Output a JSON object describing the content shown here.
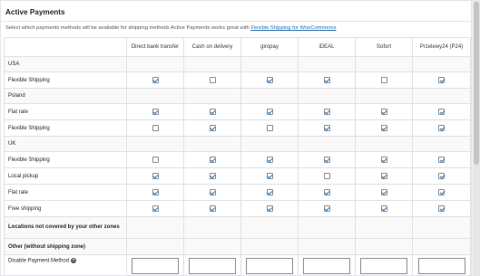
{
  "section": {
    "title": "Active Payments",
    "description_prefix": "Select which payments methods will be available for shipping methods Active Payments works great with ",
    "description_link": "Flexible Shipping for WooCommerce"
  },
  "columns": [
    "Direct bank transfer",
    "Cash on delivery",
    "giropay",
    "iDEAL",
    "Sofort",
    "Przelewy24 (P24)"
  ],
  "rows": [
    {
      "type": "group",
      "label": "USA"
    },
    {
      "type": "method",
      "label": "Flexible Shipping",
      "checks": [
        true,
        false,
        true,
        true,
        false,
        true
      ]
    },
    {
      "type": "group",
      "label": "Poland"
    },
    {
      "type": "method",
      "label": "Flat rate",
      "checks": [
        true,
        true,
        true,
        true,
        true,
        true
      ]
    },
    {
      "type": "method",
      "label": "Flexible Shipping",
      "checks": [
        false,
        true,
        false,
        true,
        true,
        true
      ]
    },
    {
      "type": "group",
      "label": "UK"
    },
    {
      "type": "method",
      "label": "Flexible Shipping",
      "checks": [
        false,
        true,
        true,
        true,
        true,
        true
      ]
    },
    {
      "type": "method",
      "label": "Local pickup",
      "checks": [
        true,
        true,
        true,
        false,
        true,
        true
      ]
    },
    {
      "type": "method",
      "label": "Flat rate",
      "checks": [
        true,
        true,
        true,
        true,
        true,
        true
      ]
    },
    {
      "type": "method",
      "label": "Free shipping",
      "checks": [
        true,
        true,
        true,
        true,
        true,
        true
      ]
    }
  ],
  "locations_label": "Locations not covered by your other zones",
  "other_label": "Other (without shipping zone)",
  "disable_label": "Disable Payment Method",
  "icons": {
    "help": "question-icon",
    "checkbox": "checkbox"
  },
  "colors": {
    "link": "#2271b1",
    "check": "#2271b1"
  }
}
